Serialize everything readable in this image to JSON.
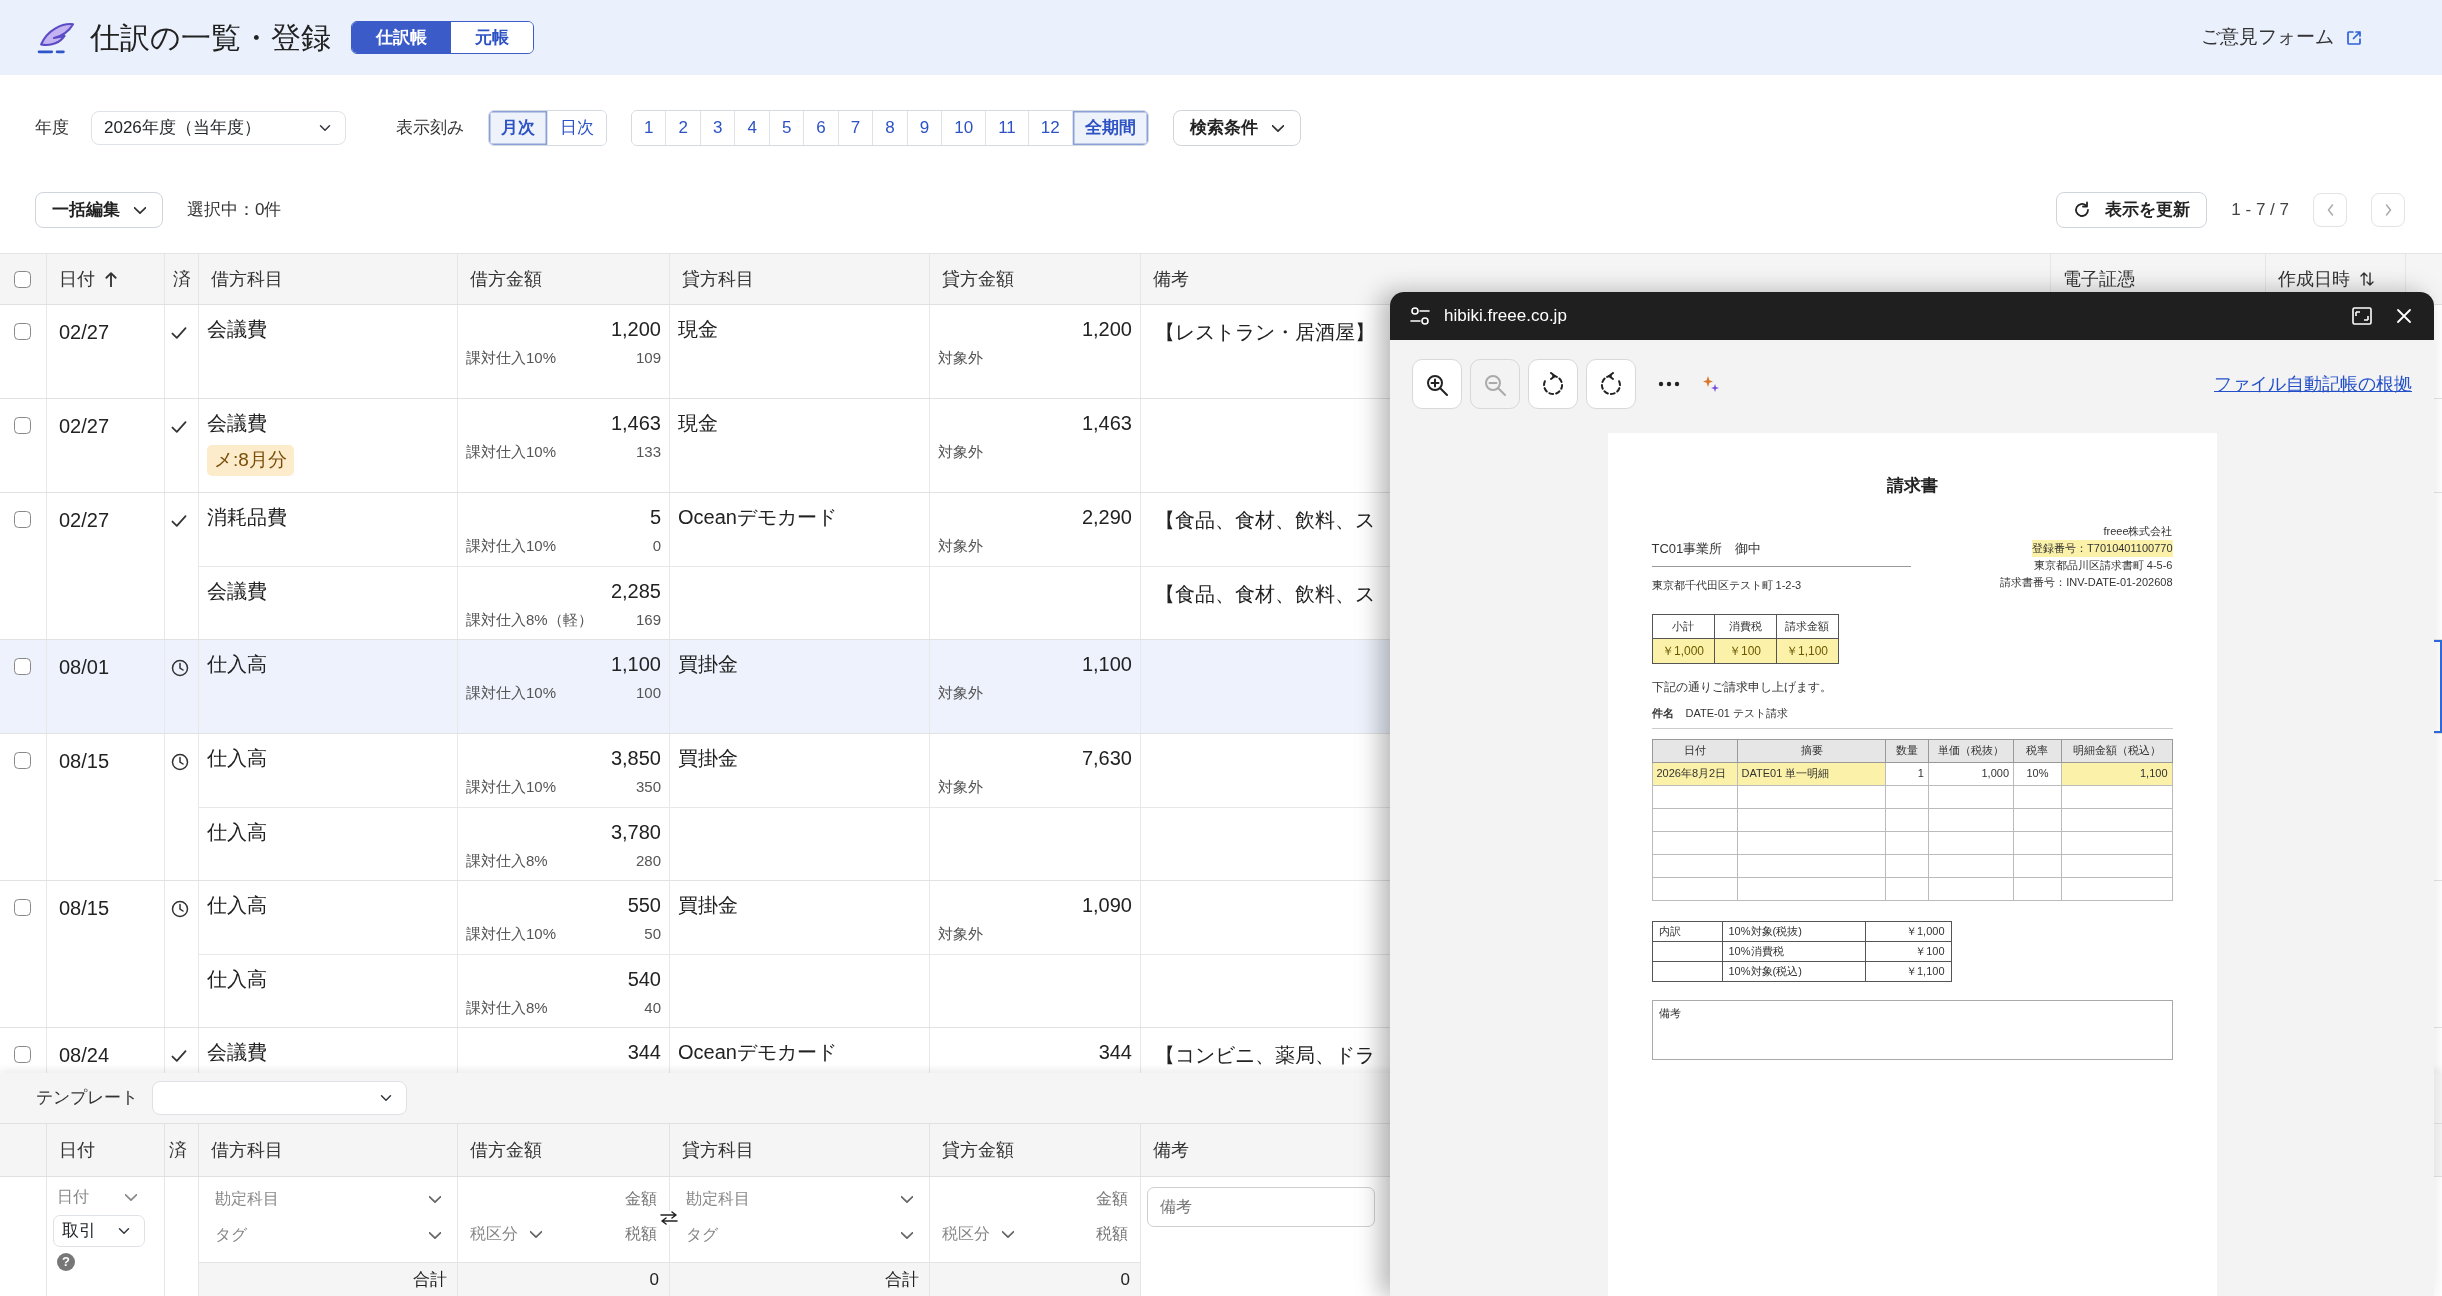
{
  "header": {
    "title": "仕訳の一覧・登録",
    "view_tabs": [
      {
        "label": "仕訳帳",
        "selected": true
      },
      {
        "label": "元帳",
        "selected": false
      }
    ],
    "feedback_link": "ご意見フォーム"
  },
  "filters": {
    "year_label": "年度",
    "year_value": "2026年度（当年度）",
    "interval_label": "表示刻み",
    "intervals": [
      {
        "label": "月次",
        "selected": true
      },
      {
        "label": "日次",
        "selected": false
      }
    ],
    "months": [
      {
        "label": "1",
        "selected": false
      },
      {
        "label": "2",
        "selected": false
      },
      {
        "label": "3",
        "selected": false
      },
      {
        "label": "4",
        "selected": false
      },
      {
        "label": "5",
        "selected": false
      },
      {
        "label": "6",
        "selected": false
      },
      {
        "label": "7",
        "selected": false
      },
      {
        "label": "8",
        "selected": false
      },
      {
        "label": "9",
        "selected": false
      },
      {
        "label": "10",
        "selected": false
      },
      {
        "label": "11",
        "selected": false
      },
      {
        "label": "12",
        "selected": false
      },
      {
        "label": "全期間",
        "selected": true
      }
    ],
    "search_button": "検索条件"
  },
  "toolbar": {
    "bulk_edit": "一括編集",
    "selection": "選択中：0件",
    "refresh": "表示を更新",
    "range": "1 - 7 / 7"
  },
  "table": {
    "select_all_checked": false,
    "columns": [
      {
        "label": "日付",
        "kind": "sorted"
      },
      {
        "label": "済"
      },
      {
        "label": "借方科目"
      },
      {
        "label": "借方金額"
      },
      {
        "label": "貸方科目"
      },
      {
        "label": "貸方金額"
      },
      {
        "label": "備考"
      },
      {
        "label": "電子証憑"
      },
      {
        "label": "作成日時",
        "kind": "sortable"
      }
    ],
    "entries": [
      {
        "date": "02/27",
        "checked": false,
        "selected": false,
        "settled": true,
        "lines": [
          {
            "debit_account": "会議費",
            "debit_amount": "1,200",
            "debit_tax": "課対仕入10%",
            "debit_tax_amount": "109",
            "credit_account": "現金",
            "credit_amount": "1,200",
            "credit_tax": "対象外",
            "memo": "【レストラン・居酒屋】"
          }
        ]
      },
      {
        "date": "02/27",
        "checked": false,
        "selected": false,
        "settled": true,
        "lines": [
          {
            "debit_account": "会議費",
            "tag": "メ:8月分",
            "debit_amount": "1,463",
            "debit_tax": "課対仕入10%",
            "debit_tax_amount": "133",
            "credit_account": "現金",
            "credit_amount": "1,463",
            "credit_tax": "対象外"
          }
        ]
      },
      {
        "date": "02/27",
        "checked": false,
        "selected": false,
        "settled": true,
        "lines": [
          {
            "debit_account": "消耗品費",
            "debit_amount": "5",
            "debit_tax": "課対仕入10%",
            "debit_tax_amount": "0",
            "credit_account": "Oceanデモカード",
            "credit_amount": "2,290",
            "credit_tax": "対象外",
            "memo": "【食品、食材、飲料、ス"
          },
          {
            "debit_account": "会議費",
            "debit_amount": "2,285",
            "debit_tax": "課対仕入8%（軽）",
            "debit_tax_amount": "169",
            "memo": "【食品、食材、飲料、ス"
          }
        ]
      },
      {
        "date": "08/01",
        "checked": false,
        "selected": true,
        "settled": false,
        "lines": [
          {
            "debit_account": "仕入高",
            "debit_amount": "1,100",
            "debit_tax": "課対仕入10%",
            "debit_tax_amount": "100",
            "credit_account": "買掛金",
            "credit_amount": "1,100",
            "credit_tax": "対象外"
          }
        ]
      },
      {
        "date": "08/15",
        "checked": false,
        "selected": false,
        "settled": false,
        "lines": [
          {
            "debit_account": "仕入高",
            "debit_amount": "3,850",
            "debit_tax": "課対仕入10%",
            "debit_tax_amount": "350",
            "credit_account": "買掛金",
            "credit_amount": "7,630",
            "credit_tax": "対象外"
          },
          {
            "debit_account": "仕入高",
            "debit_amount": "3,780",
            "debit_tax": "課対仕入8%",
            "debit_tax_amount": "280"
          }
        ]
      },
      {
        "date": "08/15",
        "checked": false,
        "selected": false,
        "settled": false,
        "lines": [
          {
            "debit_account": "仕入高",
            "debit_amount": "550",
            "debit_tax": "課対仕入10%",
            "debit_tax_amount": "50",
            "credit_account": "買掛金",
            "credit_amount": "1,090",
            "credit_tax": "対象外"
          },
          {
            "debit_account": "仕入高",
            "debit_amount": "540",
            "debit_tax": "課対仕入8%",
            "debit_tax_amount": "40"
          }
        ]
      },
      {
        "date": "08/24",
        "checked": false,
        "selected": false,
        "settled": true,
        "lines": [
          {
            "debit_account": "会議費",
            "debit_amount": "344",
            "credit_account": "Oceanデモカード",
            "credit_amount": "344",
            "memo": "【コンビニ、薬局、ドラ"
          }
        ]
      }
    ]
  },
  "entry_form": {
    "template_label": "テンプレート",
    "columns": [
      "日付",
      "済",
      "借方科目",
      "借方金額",
      "貸方科目",
      "貸方金額",
      "備考"
    ],
    "date_placeholder": "日付",
    "type_value": "取引",
    "help_icon": "?",
    "debit": {
      "account_placeholder": "勘定科目",
      "tag_placeholder": "タグ",
      "amount_placeholder": "金額",
      "tax_placeholder": "税区分",
      "tax_amount_placeholder": "税額",
      "total_label": "合計",
      "total": "0"
    },
    "credit": {
      "account_placeholder": "勘定科目",
      "tag_placeholder": "タグ",
      "amount_placeholder": "金額",
      "tax_placeholder": "税区分",
      "tax_amount_placeholder": "税額",
      "total_label": "合計",
      "total": "0"
    },
    "memo_placeholder": "備考"
  },
  "viewer": {
    "url": "hibiki.freee.co.jp",
    "tools": [
      {
        "kind": "zoom-in",
        "disabled": false
      },
      {
        "kind": "zoom-out",
        "disabled": true
      },
      {
        "kind": "rotate-right",
        "disabled": false
      },
      {
        "kind": "rotate-left",
        "disabled": false
      },
      {
        "kind": "more",
        "disabled": false
      }
    ],
    "basis_link": "ファイル自動記帳の根拠",
    "document": {
      "title": "請求書",
      "recipient": "TC01事業所　御中",
      "recipient_address": "東京都千代田区テスト町 1-2-3",
      "issuer": "freee株式会社",
      "registration": {
        "text": "登録番号：T7010401100770",
        "highlighted": true
      },
      "issuer_address": "東京都品川区請求書町 4-5-6",
      "invoice_number": "請求書番号：INV-DATE-01-202608",
      "summary": {
        "headers": [
          "小計",
          "消費税",
          "請求金額"
        ],
        "values": [
          "￥1,000",
          "￥100",
          "￥1,100"
        ],
        "highlighted": true
      },
      "greeting": "下記の通りご請求申し上げます。",
      "subject_label": "件名",
      "subject": "DATE-01 テスト請求",
      "items": {
        "columns": [
          "日付",
          "摘要",
          "数量",
          "単価（税抜）",
          "税率",
          "明細金額（税込）"
        ],
        "rows": [
          [
            {
              "text": "2026年8月2日",
              "highlighted": true
            },
            {
              "text": "DATE01 単一明細",
              "highlighted": true
            },
            {
              "text": "1",
              "highlighted": false
            },
            {
              "text": "1,000",
              "highlighted": false
            },
            {
              "text": "10%",
              "highlighted": false
            },
            {
              "text": "1,100",
              "highlighted": true
            }
          ]
        ]
      },
      "breakdown": [
        {
          "label": "内訳",
          "name": "10%対象(税抜)",
          "amount": "￥1,000"
        },
        {
          "name": "10%消費税",
          "amount": "￥100"
        },
        {
          "name": "10%対象(税込)",
          "amount": "￥1,100"
        }
      ],
      "remarks_label": "備考"
    }
  }
}
